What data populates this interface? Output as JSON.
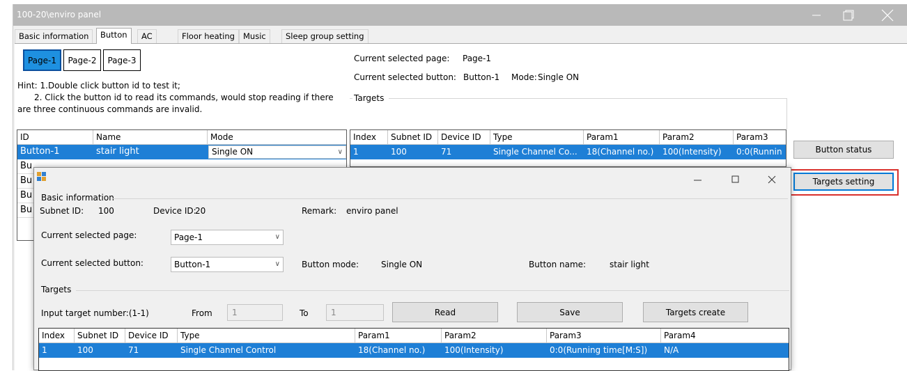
{
  "window": {
    "title": "100-20\\enviro panel"
  },
  "tabs": [
    "Basic information",
    "Button",
    "AC",
    "Floor heating",
    "Music",
    "Sleep group setting"
  ],
  "pages": [
    "Page-1",
    "Page-2",
    "Page-3"
  ],
  "hint": {
    "line1": "Hint:  1.Double click button id to test it;",
    "line2": "2. Click the button id to read its commands, would stop reading if there",
    "line3": "are three continuous commands are invalid."
  },
  "status": {
    "page_label": "Current selected page:",
    "page_value": "Page-1",
    "button_label": "Current selected button:",
    "button_value": "Button-1",
    "mode_label": "Mode:",
    "mode_value": "Single ON"
  },
  "targets_group": "Targets",
  "button_table": {
    "headers": [
      "ID",
      "Name",
      "Mode"
    ],
    "rows": [
      [
        "Button-1",
        "stair light",
        "Single ON"
      ],
      [
        "Bu",
        "",
        ""
      ],
      [
        "Bu",
        "",
        ""
      ],
      [
        "Bu",
        "",
        ""
      ],
      [
        "Bu",
        "",
        ""
      ]
    ]
  },
  "targets_table": {
    "headers": [
      "Index",
      "Subnet ID",
      "Device ID",
      "Type",
      "Param1",
      "Param2",
      "Param3"
    ],
    "rows": [
      [
        "1",
        "100",
        "71",
        "Single Channel Co...",
        "18(Channel no.)",
        "100(Intensity)",
        "0:0(Runnin"
      ]
    ]
  },
  "side_buttons": {
    "status": "Button status",
    "targets": "Targets setting"
  },
  "highlight_color": "#d9302c",
  "dialog": {
    "basic_group": "Basic information",
    "subnet_label": "Subnet ID:",
    "subnet_value": "100",
    "device_label": "Device ID:",
    "device_value": "20",
    "remark_label": "Remark:",
    "remark_value": "enviro panel",
    "page_label": "Current selected page:",
    "page_value": "Page-1",
    "button_label": "Current selected button:",
    "button_value": "Button-1",
    "mode_label": "Button mode:",
    "mode_value": "Single ON",
    "name_label": "Button name:",
    "name_value": "stair light",
    "targets_group": "Targets",
    "input_label": "Input target number:(1-1)",
    "from_label": "From",
    "from_value": "1",
    "to_label": "To",
    "to_value": "1",
    "read": "Read",
    "save": "Save",
    "create": "Targets create",
    "table": {
      "headers": [
        "Index",
        "Subnet ID",
        "Device ID",
        "Type",
        "Param1",
        "Param2",
        "Param3",
        "Param4"
      ],
      "rows": [
        [
          "1",
          "100",
          "71",
          "Single Channel Control",
          "18(Channel no.)",
          "100(Intensity)",
          "0:0(Running time[M:S])",
          "N/A"
        ]
      ]
    }
  }
}
